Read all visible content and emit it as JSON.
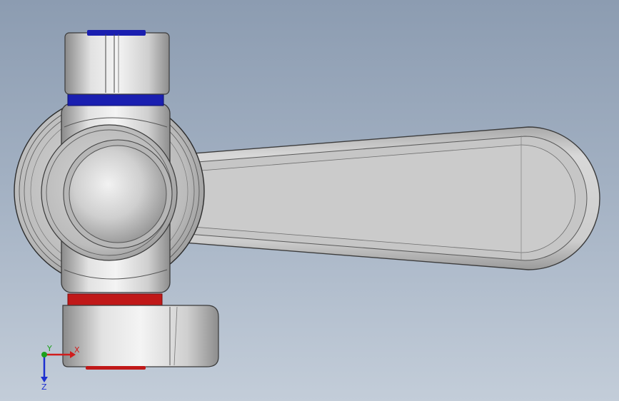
{
  "viewport": {
    "background_top": "#8c9cb1",
    "background_bottom": "#c3cdd9"
  },
  "model": {
    "part": "ball-valve-with-lever-handle",
    "seal_top_color": "#1a1fb0",
    "seal_bottom_color": "#c01818",
    "body_color": "#c8c8c8"
  },
  "triad": {
    "x_label": "X",
    "y_label": "Y",
    "z_label": "Z",
    "x_color": "#d01c1c",
    "y_color": "#1ca01c",
    "z_color": "#1c2fd0"
  }
}
